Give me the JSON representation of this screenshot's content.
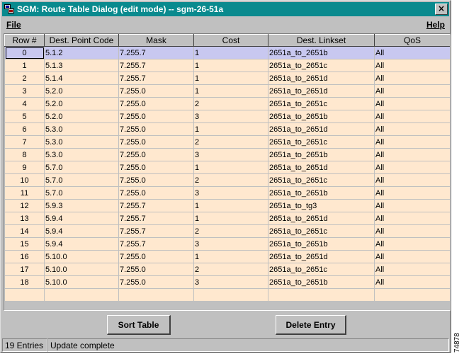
{
  "window": {
    "title": "SGM: Route Table Dialog (edit mode) -- sgm-26-51a",
    "close_label": "×"
  },
  "menu": {
    "file": "File",
    "help": "Help"
  },
  "table": {
    "columns": [
      "Row #",
      "Dest. Point Code",
      "Mask",
      "Cost",
      "Dest. Linkset",
      "QoS"
    ],
    "selected_row": 0,
    "rows": [
      [
        "0",
        "5.1.2",
        "7.255.7",
        "1",
        "2651a_to_2651b",
        "All"
      ],
      [
        "1",
        "5.1.3",
        "7.255.7",
        "1",
        "2651a_to_2651c",
        "All"
      ],
      [
        "2",
        "5.1.4",
        "7.255.7",
        "1",
        "2651a_to_2651d",
        "All"
      ],
      [
        "3",
        "5.2.0",
        "7.255.0",
        "1",
        "2651a_to_2651d",
        "All"
      ],
      [
        "4",
        "5.2.0",
        "7.255.0",
        "2",
        "2651a_to_2651c",
        "All"
      ],
      [
        "5",
        "5.2.0",
        "7.255.0",
        "3",
        "2651a_to_2651b",
        "All"
      ],
      [
        "6",
        "5.3.0",
        "7.255.0",
        "1",
        "2651a_to_2651d",
        "All"
      ],
      [
        "7",
        "5.3.0",
        "7.255.0",
        "2",
        "2651a_to_2651c",
        "All"
      ],
      [
        "8",
        "5.3.0",
        "7.255.0",
        "3",
        "2651a_to_2651b",
        "All"
      ],
      [
        "9",
        "5.7.0",
        "7.255.0",
        "1",
        "2651a_to_2651d",
        "All"
      ],
      [
        "10",
        "5.7.0",
        "7.255.0",
        "2",
        "2651a_to_2651c",
        "All"
      ],
      [
        "11",
        "5.7.0",
        "7.255.0",
        "3",
        "2651a_to_2651b",
        "All"
      ],
      [
        "12",
        "5.9.3",
        "7.255.7",
        "1",
        "2651a_to_tg3",
        "All"
      ],
      [
        "13",
        "5.9.4",
        "7.255.7",
        "1",
        "2651a_to_2651d",
        "All"
      ],
      [
        "14",
        "5.9.4",
        "7.255.7",
        "2",
        "2651a_to_2651c",
        "All"
      ],
      [
        "15",
        "5.9.4",
        "7.255.7",
        "3",
        "2651a_to_2651b",
        "All"
      ],
      [
        "16",
        "5.10.0",
        "7.255.0",
        "1",
        "2651a_to_2651d",
        "All"
      ],
      [
        "17",
        "5.10.0",
        "7.255.0",
        "2",
        "2651a_to_2651c",
        "All"
      ],
      [
        "18",
        "5.10.0",
        "7.255.0",
        "3",
        "2651a_to_2651b",
        "All"
      ]
    ]
  },
  "buttons": {
    "sort": "Sort Table",
    "delete": "Delete Entry"
  },
  "status": {
    "entries": "19 Entries",
    "message": "Update complete"
  },
  "figure_id": "74878",
  "colors": {
    "titlebar": "#0a8a8e",
    "row_bg": "#ffe8cf",
    "selected_row_bg": "#c8c8f0",
    "chrome": "#c0c0c0"
  }
}
